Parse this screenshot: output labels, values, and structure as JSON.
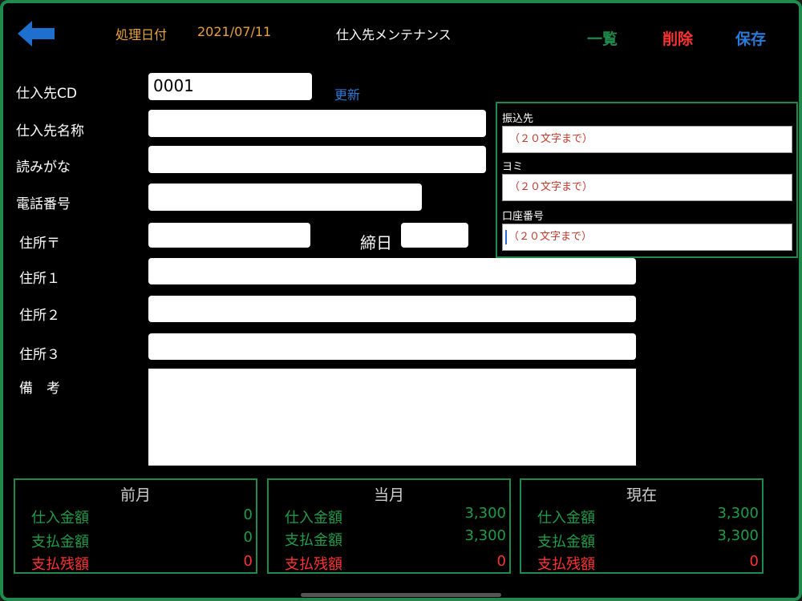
{
  "header": {
    "date_label": "処理日付",
    "date_value": "2021/07/11",
    "title": "仕入先メンテナンス",
    "list_label": "一覧",
    "delete_label": "削除",
    "save_label": "保存"
  },
  "colors": {
    "accent_green": "#1f8a4c",
    "delete_red": "#ff3333",
    "save_blue": "#2a7bd6",
    "date_orange": "#e8a33d"
  },
  "form": {
    "supplier_cd_label": "仕入先CD",
    "supplier_cd_value": "0001",
    "update_label": "更新",
    "name_label": "仕入先名称",
    "name_value": "",
    "kana_label": "読みがな",
    "kana_value": "",
    "phone_label": "電話番号",
    "phone_value": "",
    "zip_label": "住所〒",
    "zip_value": "",
    "closing_day_label": "締日",
    "closing_day_value": "",
    "address1_label": "住所１",
    "address2_label": "住所２",
    "address3_label": "住所３",
    "note_label": "備　考"
  },
  "bank": {
    "transfer_label": "振込先",
    "transfer_placeholder": "（２０文字まで）",
    "yomi_label": "ヨミ",
    "yomi_placeholder": "（２０文字まで）",
    "account_label": "口座番号",
    "account_placeholder": "（２０文字まで）"
  },
  "summary": {
    "purchase_label": "仕入金額",
    "payment_label": "支払金額",
    "balance_label": "支払残額",
    "panels": [
      {
        "title": "前月",
        "purchase": "0",
        "payment": "0",
        "balance": "0"
      },
      {
        "title": "当月",
        "purchase": "3,300",
        "payment": "3,300",
        "balance": "0"
      },
      {
        "title": "現在",
        "purchase": "3,300",
        "payment": "3,300",
        "balance": "0"
      }
    ]
  }
}
